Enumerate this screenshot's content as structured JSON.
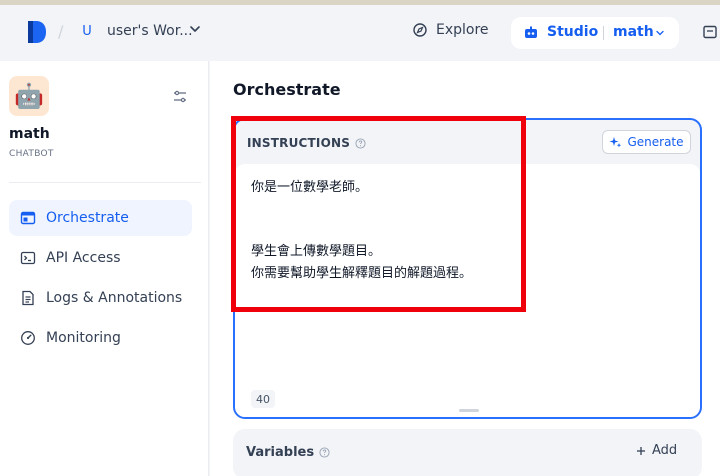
{
  "header": {
    "workspace_initial": "U",
    "workspace_name": "user's Wor...",
    "explore_label": "Explore",
    "studio_label": "Studio",
    "app_label": "math"
  },
  "sidebar": {
    "app_name": "math",
    "app_type": "CHATBOT",
    "app_emoji": "🤖",
    "items": [
      {
        "label": "Orchestrate",
        "active": true
      },
      {
        "label": "API Access",
        "active": false
      },
      {
        "label": "Logs & Annotations",
        "active": false
      },
      {
        "label": "Monitoring",
        "active": false
      }
    ]
  },
  "main": {
    "title": "Orchestrate",
    "instructions": {
      "title": "INSTRUCTIONS",
      "generate_label": "Generate",
      "lines": [
        "你是一位數學老師。",
        "學生會上傳數學題目。",
        "你需要幫助學生解釋題目的解題過程。"
      ],
      "char_count": "40"
    },
    "variables": {
      "title": "Variables",
      "add_label": "Add"
    }
  },
  "colors": {
    "accent": "#155eef",
    "highlight": "#f0000b"
  }
}
